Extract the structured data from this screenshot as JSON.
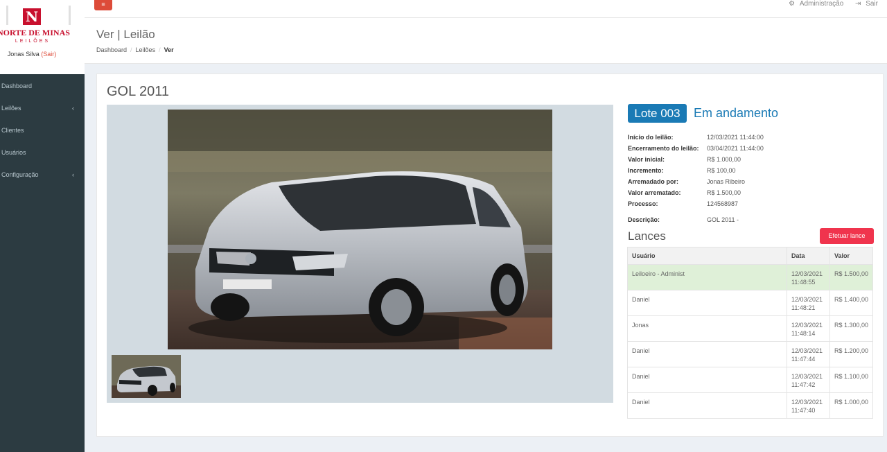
{
  "sidebar": {
    "logo_mark": "N",
    "logo_name": "NORTE DE MINAS",
    "logo_sub": "LEILÕES",
    "user_name": "Jonas Silva",
    "user_logout": "(Sair)",
    "items": [
      {
        "label": "Dashboard",
        "has_submenu": false
      },
      {
        "label": "Leilões",
        "has_submenu": true
      },
      {
        "label": "Clientes",
        "has_submenu": false
      },
      {
        "label": "Usuários",
        "has_submenu": false
      },
      {
        "label": "Configuração",
        "has_submenu": true
      }
    ],
    "chevron": "‹"
  },
  "topbar": {
    "toggle_icon": "≡",
    "admin_label": "Administração",
    "logout_label": "Sair",
    "admin_icon": "⚙",
    "logout_icon": "⇥"
  },
  "header": {
    "title": "Ver | Leilão",
    "breadcrumb": [
      "Dashboard",
      "Leilões",
      "Ver"
    ],
    "breadcrumb_sep": "/"
  },
  "item": {
    "title": "GOL 2011",
    "lot_label": "Lote 003",
    "status": "Em andamento",
    "details": [
      {
        "key": "Início do leilão:",
        "value": "12/03/2021 11:44:00"
      },
      {
        "key": "Encerramento do leilão:",
        "value": "03/04/2021 11:44:00"
      },
      {
        "key": "Valor inicial:",
        "value": "R$ 1.000,00"
      },
      {
        "key": "Incremento:",
        "value": "R$ 100,00"
      },
      {
        "key": "Arremadado por:",
        "value": "Jonas Ribeiro"
      },
      {
        "key": "Valor arrematado:",
        "value": "R$ 1.500,00"
      },
      {
        "key": "Processo:",
        "value": "124568987"
      }
    ],
    "description": {
      "key": "Descrição:",
      "value": "GOL 2011 -"
    }
  },
  "bids": {
    "title": "Lances",
    "button_label": "Efetuar lance",
    "headers": [
      "Usuário",
      "Data",
      "Valor"
    ],
    "rows": [
      {
        "user": "Leiloeiro - Administ",
        "date": "12/03/2021",
        "time": "11:48:55",
        "value": "R$ 1.500,00"
      },
      {
        "user": "Daniel",
        "date": "12/03/2021",
        "time": "11:48:21",
        "value": "R$ 1.400,00"
      },
      {
        "user": "Jonas",
        "date": "12/03/2021",
        "time": "11:48:14",
        "value": "R$ 1.300,00"
      },
      {
        "user": "Daniel",
        "date": "12/03/2021",
        "time": "11:47:44",
        "value": "R$ 1.200,00"
      },
      {
        "user": "Daniel",
        "date": "12/03/2021",
        "time": "11:47:42",
        "value": "R$ 1.100,00"
      },
      {
        "user": "Daniel",
        "date": "12/03/2021",
        "time": "11:47:40",
        "value": "R$ 1.000,00"
      }
    ]
  },
  "colors": {
    "sidebar_bg": "#2c3b41",
    "accent_red": "#dd4b39",
    "lot_blue": "#1a7ab5",
    "winner_row": "#dff0d8"
  }
}
